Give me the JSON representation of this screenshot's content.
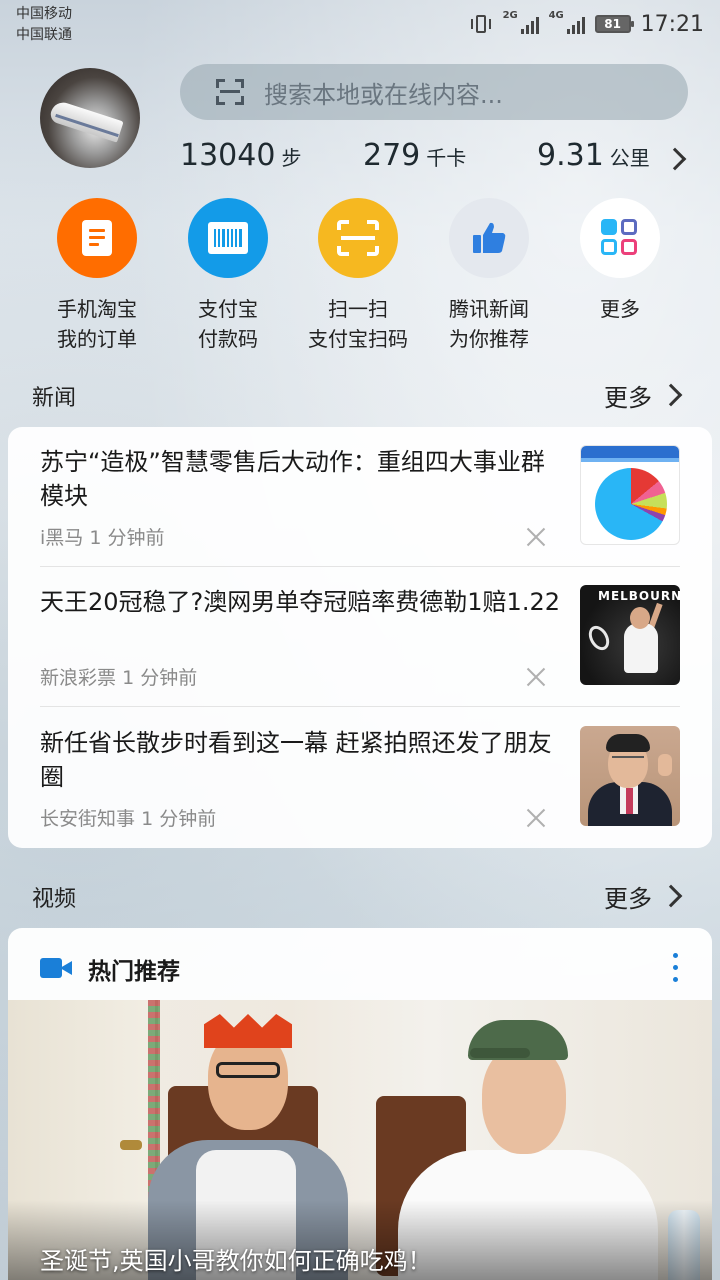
{
  "status_bar": {
    "carrier_1": "中国移动",
    "carrier_2": "中国联通",
    "signal_1_tag": "2G",
    "signal_2_tag": "4G",
    "battery": "81",
    "time": "17:21"
  },
  "header": {
    "search_placeholder": "搜索本地或在线内容...",
    "stats": [
      {
        "value": "13040",
        "unit": "步"
      },
      {
        "value": "279",
        "unit": "千卡"
      },
      {
        "value": "9.31",
        "unit": "公里"
      }
    ]
  },
  "shortcuts": [
    {
      "line1": "手机淘宝",
      "line2": "我的订单",
      "color": "#ff6d00",
      "icon": "document-icon"
    },
    {
      "line1": "支付宝",
      "line2": "付款码",
      "color": "#139be8",
      "icon": "barcode-icon"
    },
    {
      "line1": "扫一扫",
      "line2": "支付宝扫码",
      "color": "#f6b820",
      "icon": "scan-icon"
    },
    {
      "line1": "腾讯新闻",
      "line2": "为你推荐",
      "color": "#e4e8ee",
      "icon": "thumbs-up-icon"
    },
    {
      "line1": "更多",
      "line2": "",
      "color": "#ffffff",
      "icon": "apps-grid-icon"
    }
  ],
  "news": {
    "section_title": "新闻",
    "more_label": "更多",
    "items": [
      {
        "title": "苏宁“造极”智慧零售后大动作：重组四大事业群模块",
        "source": "i黑马",
        "time": "1 分钟前"
      },
      {
        "title": "天王20冠稳了?澳网男单夺冠赔率费德勒1赔1.22",
        "source": "新浪彩票",
        "time": "1 分钟前"
      },
      {
        "title": "新任省长散步时看到这一幕 赶紧拍照还发了朋友圈",
        "source": "长安街知事",
        "time": "1 分钟前"
      }
    ],
    "thumb2_banner": "MELBOURN"
  },
  "video": {
    "section_title": "视频",
    "more_label": "更多",
    "card_title": "热门推荐",
    "caption": "圣诞节,英国小哥教你如何正确吃鸡！"
  }
}
